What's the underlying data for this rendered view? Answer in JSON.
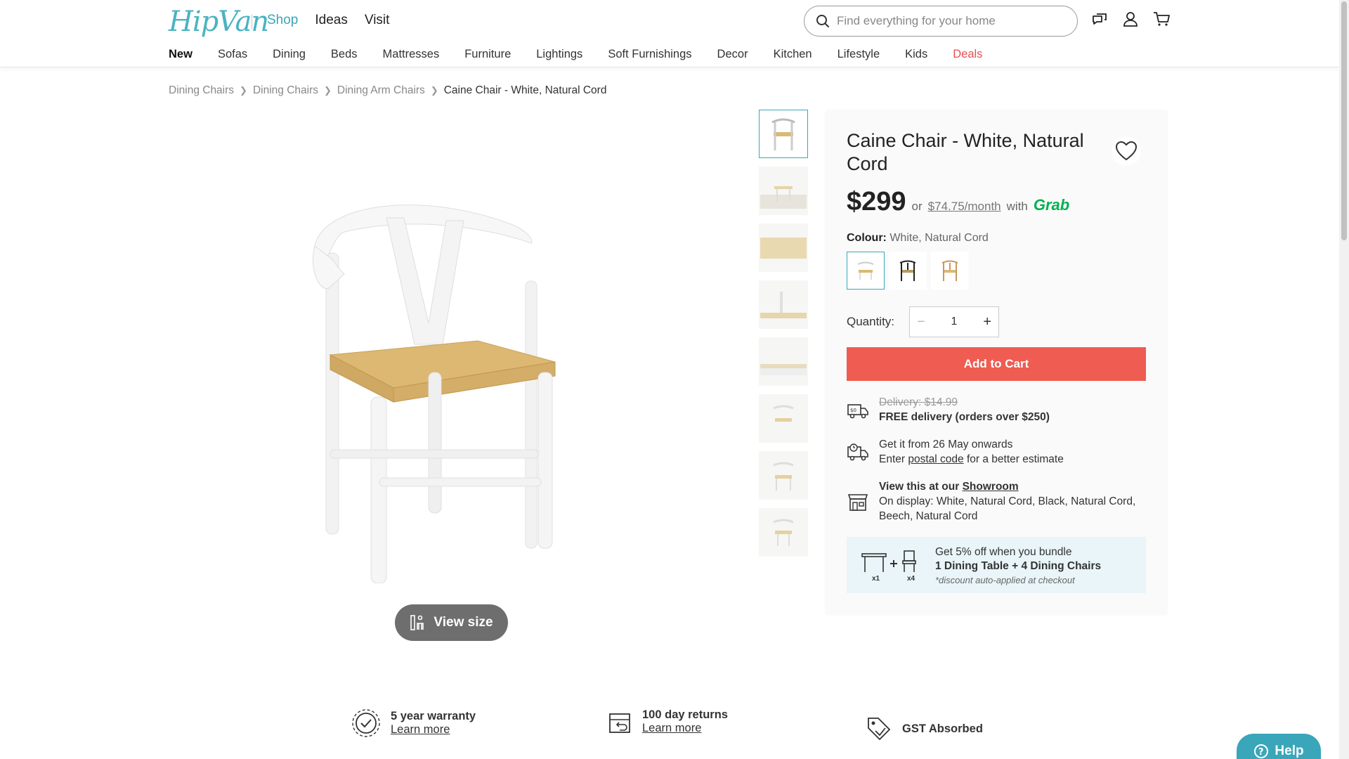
{
  "header": {
    "logo": "HipVan",
    "top_nav": [
      {
        "label": "Shop",
        "active": true
      },
      {
        "label": "Ideas",
        "active": false
      },
      {
        "label": "Visit",
        "active": false
      }
    ],
    "search_placeholder": "Find everything for your home",
    "icons": [
      "chat-icon",
      "user-icon",
      "cart-icon"
    ]
  },
  "categories": [
    "New",
    "Sofas",
    "Dining",
    "Beds",
    "Mattresses",
    "Furniture",
    "Lightings",
    "Soft Furnishings",
    "Decor",
    "Kitchen",
    "Lifestyle",
    "Kids",
    "Deals"
  ],
  "breadcrumb": [
    "Dining Chairs",
    "Dining Chairs",
    "Dining Arm Chairs",
    "Caine Chair - White, Natural Cord"
  ],
  "gallery": {
    "thumbnail_count": 8,
    "selected_index": 0,
    "view_size_label": "View size"
  },
  "product": {
    "title": "Caine Chair - White, Natural Cord",
    "price": "$299",
    "or": "or",
    "monthly": "$74.75/month",
    "with": "with",
    "grab": "Grab",
    "colour_label": "Colour:",
    "colour_value": "White, Natural Cord",
    "quantity_label": "Quantity:",
    "quantity_value": "1",
    "add_to_cart": "Add to Cart"
  },
  "delivery": {
    "old": "Delivery: $14.99",
    "free": "FREE delivery (orders over $250)",
    "eta": "Get it from 26 May onwards",
    "enter": "Enter",
    "postal": "postal code",
    "estimate": "for a better estimate",
    "showroom_prefix": "View this at our",
    "showroom": "Showroom",
    "display": "On display: White, Natural Cord, Black, Natural Cord, Beech, Natural Cord"
  },
  "bundle": {
    "line1": "Get 5% off when you bundle",
    "line2": "1 Dining Table + 4 Dining Chairs",
    "note": "*discount auto-applied at checkout",
    "x1": "x1",
    "x4": "x4"
  },
  "benefits": [
    {
      "title": "5 year warranty",
      "link": "Learn more"
    },
    {
      "title": "100 day returns",
      "link": "Learn more"
    },
    {
      "title": "GST Absorbed"
    }
  ],
  "help_label": "Help",
  "colors": {
    "accent": "#3aa6b9",
    "cta": "#ef5c52",
    "deals": "#e94e4e",
    "grab": "#00b14f"
  }
}
